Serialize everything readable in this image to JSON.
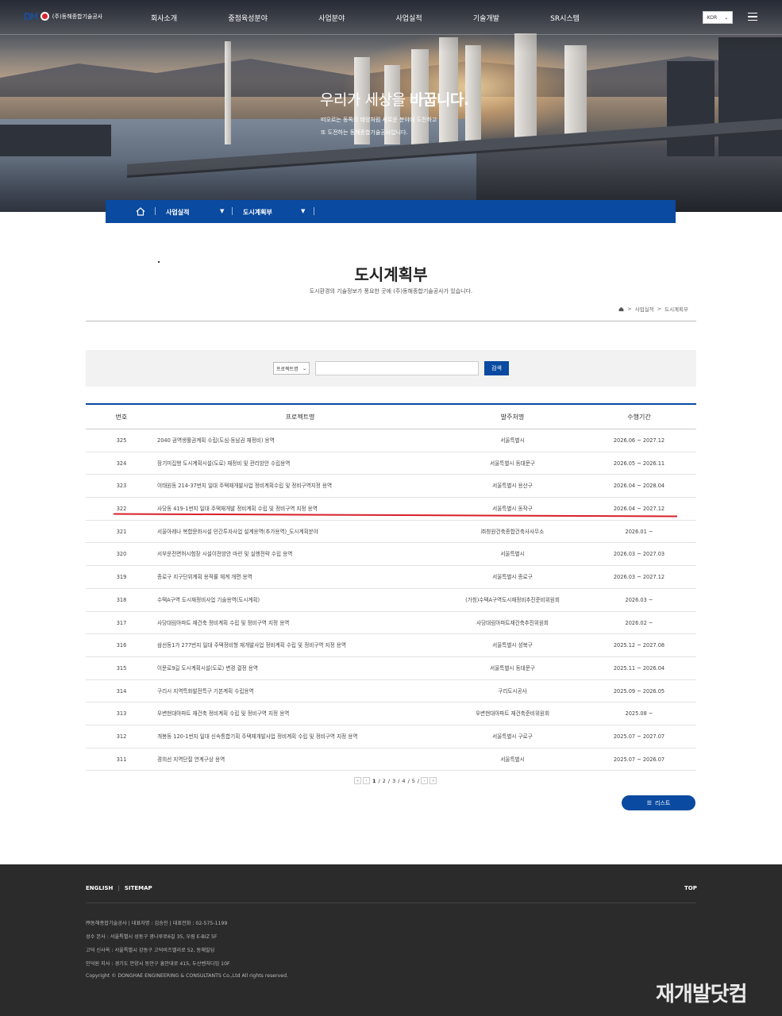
{
  "header": {
    "logo_text": "DH",
    "company_name": "(주)동해종합기술공사",
    "menu": [
      "회사소개",
      "중점육성분야",
      "사업분야",
      "사업실적",
      "기술개발",
      "SR시스템"
    ],
    "lang": "KOR"
  },
  "hero": {
    "title_light": "우리가 세상을 ",
    "title_bold": "바꿉니다.",
    "sub1": "떠오르는 동쪽의 태양처럼 새로운 분야에 도전하고",
    "sub2": "또 도전하는 동해종합기술공사입니다."
  },
  "subnav": {
    "item1": "사업실적",
    "item2": "도시계획부"
  },
  "page": {
    "title": "도시계획부",
    "desc": "도시환경의 기술정보가 풍요한 곳에 (주)동해종합기술공사가 있습니다.",
    "crumb1": "사업실적",
    "crumb2": "도시계획부"
  },
  "search": {
    "select_value": "프로젝트명",
    "button": "검색"
  },
  "table": {
    "headers": {
      "no": "번호",
      "name": "프로젝트명",
      "org": "발주처명",
      "period": "수행기간"
    },
    "rows": [
      {
        "no": "325",
        "name": "2040 권역생활권계획 수립(도심·동남권 재정비) 용역",
        "org": "서울특별시",
        "period": "2026.06 ~ 2027.12"
      },
      {
        "no": "324",
        "name": "장기미집행 도시계획시설(도로) 재정비 및 관리방안 수립용역",
        "org": "서울특별시 동대문구",
        "period": "2026.05 ~ 2026.11"
      },
      {
        "no": "323",
        "name": "이태원동 214-37번지 일대 주택재개발사업 정비계획수립 및 정비구역지정 용역",
        "org": "서울특별시 용산구",
        "period": "2026.04 ~ 2028.04"
      },
      {
        "no": "322",
        "name": "사당동 419-1번지 일대 주택재개발 정비계획 수립 및 정비구역 지정 용역",
        "org": "서울특별시 동작구",
        "period": "2026.04 ~ 2027.12"
      },
      {
        "no": "321",
        "name": "서울아레나 복합문화시설 민간투자사업 설계용역(추가용역)_도시계획분야",
        "org": "㈜창원건축종합건축사사무소",
        "period": "2026.01 ~"
      },
      {
        "no": "320",
        "name": "서부운전면허시험장 시설이전방안 마련 및 실행전략 수립 용역",
        "org": "서울특별시",
        "period": "2026.03 ~ 2027.03"
      },
      {
        "no": "319",
        "name": "종로구 지구단위계획 용적률 체계 개편 용역",
        "org": "서울특별시 종로구",
        "period": "2026.03 ~ 2027.12"
      },
      {
        "no": "318",
        "name": "수택A구역 도시재정비사업 기술용역(도시계획)",
        "org": "(가칭)수택A구역도시재정비추진준비위원회",
        "period": "2026.03 ~"
      },
      {
        "no": "317",
        "name": "사당대림아파트 재건축 정비계획 수립 및 정비구역 지정 용역",
        "org": "사당대림아파트재건축추진위원회",
        "period": "2026.02 ~"
      },
      {
        "no": "316",
        "name": "삼선동1가 277번지 일대 주택정비형 재개발사업 정비계획 수립 및 정비구역 지정 용역",
        "org": "서울특별시 성북구",
        "period": "2025.12 ~ 2027.08"
      },
      {
        "no": "315",
        "name": "이문로9길 도시계획시설(도로) 변경 결정 용역",
        "org": "서울특별시 동대문구",
        "period": "2025.11 ~ 2026.04"
      },
      {
        "no": "314",
        "name": "구리시 지역특화발전특구 기본계획 수립용역",
        "org": "구리도시공사",
        "period": "2025.09 ~ 2026.05"
      },
      {
        "no": "313",
        "name": "우변현대아파트 재건축 정비계획 수립 및 정비구역 지정 용역",
        "org": "우변현대아파트 재건축준비위원회",
        "period": "2025.08 ~"
      },
      {
        "no": "312",
        "name": "개봉동 120-1번지 일대 신속통합기획 주택재개발사업 정비계획 수립 및 정비구역 지정 용역",
        "org": "서울특별시 구로구",
        "period": "2025.07 ~ 2027.07"
      },
      {
        "no": "311",
        "name": "경의선 지역단절 연계구상 용역",
        "org": "서울특별시",
        "period": "2025.07 ~ 2026.07"
      }
    ]
  },
  "pager": {
    "prev_first": "«",
    "prev": "‹",
    "pages": [
      "1",
      "2",
      "3",
      "4",
      "5"
    ],
    "next": "›",
    "next_last": "»"
  },
  "list_button": "리스트",
  "footer": {
    "link1": "ENGLISH",
    "link2": "SITEMAP",
    "top": "TOP",
    "info1": "㈜동해종합기술공사 | 대표자명 : 김승진 | 대표전화 : 02-575-1199",
    "info2": "성수 본사 : 서울특별시 성동구 광나루로6길 35, 우림 E-BIZ 5F",
    "info3": "고덕 신사옥 : 서울특별시 강동구 고덕비즈밸리로 52, 동해빌딩",
    "info4": "인덕원 지사 : 경기도 안양시 동안구 흥안대로 415, 두산벤처다임 10F",
    "copyright": "Copyright © DONGHAE ENGINEERING & CONSULTANTS Co.,Ltd All rights reserved."
  },
  "watermark": "재개발닷컴"
}
